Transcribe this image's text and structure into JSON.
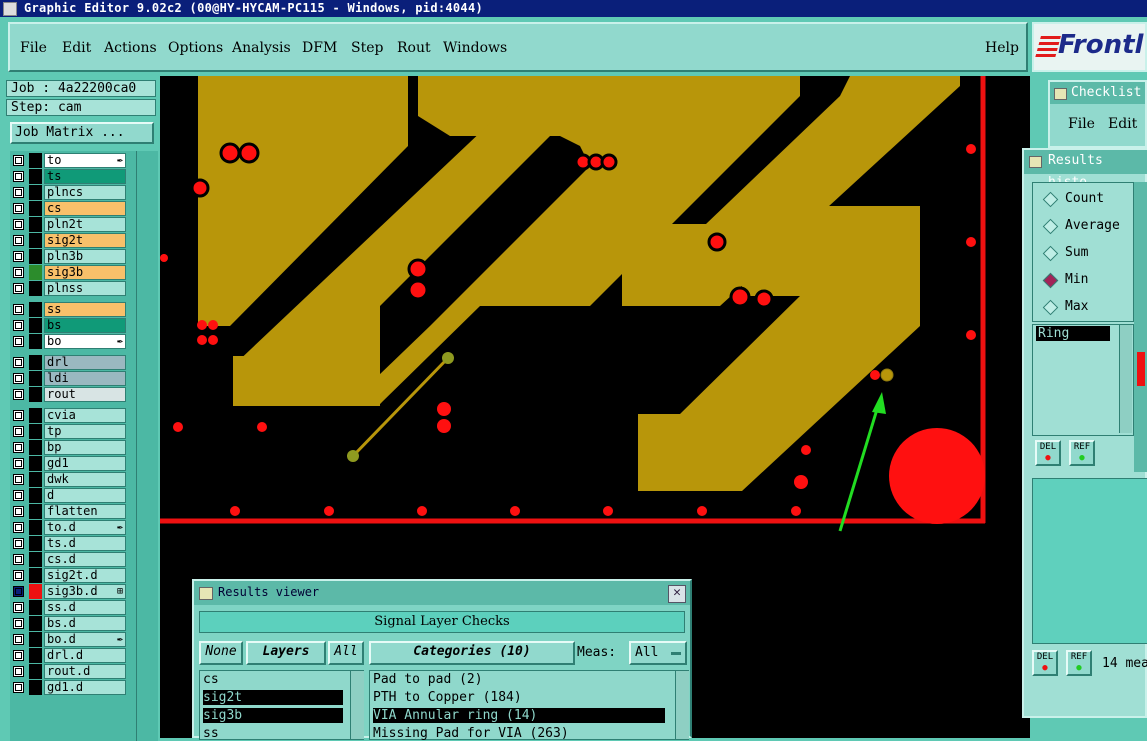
{
  "window": {
    "title": "Graphic Editor 9.02c2 (00@HY-HYCAM-PC115 - Windows, pid:4044)"
  },
  "menu": {
    "items": [
      "File",
      "Edit",
      "Actions",
      "Options",
      "Analysis",
      "DFM",
      "Step",
      "Rout",
      "Windows"
    ],
    "help": "Help"
  },
  "brand": {
    "text": "Frontl"
  },
  "job": {
    "job_label": "Job : 4a22200ca0",
    "step_label": "Step: cam",
    "matrix_button": "Job Matrix ..."
  },
  "layers": [
    {
      "name": "to",
      "color": "#ffffff",
      "swatch": "#000000",
      "mark": "✒"
    },
    {
      "name": "ts",
      "color": "#109a78",
      "swatch": "#000000",
      "mark": ""
    },
    {
      "name": "plncs",
      "color": "#a7e3d8",
      "swatch": "#000000",
      "mark": ""
    },
    {
      "name": "cs",
      "color": "#f8c06a",
      "swatch": "#000000",
      "mark": ""
    },
    {
      "name": "pln2t",
      "color": "#a7e3d8",
      "swatch": "#000000",
      "mark": ""
    },
    {
      "name": "sig2t",
      "color": "#f8c06a",
      "swatch": "#000000",
      "mark": ""
    },
    {
      "name": "pln3b",
      "color": "#a7e3d8",
      "swatch": "#000000",
      "mark": ""
    },
    {
      "name": "sig3b",
      "color": "#f8c06a",
      "swatch": "#2c8c2c",
      "mark": ""
    },
    {
      "name": "plnss",
      "color": "#a7e3d8",
      "swatch": "#000000",
      "mark": ""
    },
    {
      "name": "ss",
      "color": "#f8c06a",
      "swatch": "#000000",
      "mark": ""
    },
    {
      "name": "bs",
      "color": "#109a78",
      "swatch": "#000000",
      "mark": ""
    },
    {
      "name": "bo",
      "color": "#ffffff",
      "swatch": "#000000",
      "mark": "✒"
    },
    {
      "name": "drl",
      "color": "#9ab8c0",
      "swatch": "#000000",
      "mark": ""
    },
    {
      "name": "ldi",
      "color": "#9ab8c0",
      "swatch": "#000000",
      "mark": ""
    },
    {
      "name": "rout",
      "color": "#d8e4e4",
      "swatch": "#000000",
      "mark": ""
    },
    {
      "name": "cvia",
      "color": "#a7e3d8",
      "swatch": "#000000",
      "mark": ""
    },
    {
      "name": "tp",
      "color": "#a7e3d8",
      "swatch": "#000000",
      "mark": ""
    },
    {
      "name": "bp",
      "color": "#a7e3d8",
      "swatch": "#000000",
      "mark": ""
    },
    {
      "name": "gd1",
      "color": "#a7e3d8",
      "swatch": "#000000",
      "mark": ""
    },
    {
      "name": "dwk",
      "color": "#a7e3d8",
      "swatch": "#000000",
      "mark": ""
    },
    {
      "name": "d",
      "color": "#a7e3d8",
      "swatch": "#000000",
      "mark": ""
    },
    {
      "name": "flatten",
      "color": "#a7e3d8",
      "swatch": "#000000",
      "mark": ""
    },
    {
      "name": "to.d",
      "color": "#a7e3d8",
      "swatch": "#000000",
      "mark": "✒"
    },
    {
      "name": "ts.d",
      "color": "#a7e3d8",
      "swatch": "#000000",
      "mark": ""
    },
    {
      "name": "cs.d",
      "color": "#a7e3d8",
      "swatch": "#000000",
      "mark": ""
    },
    {
      "name": "sig2t.d",
      "color": "#a7e3d8",
      "swatch": "#000000",
      "mark": ""
    },
    {
      "name": "sig3b.d",
      "color": "#a7e3d8",
      "swatch": "#ee1111",
      "mark": "⊞"
    },
    {
      "name": "ss.d",
      "color": "#a7e3d8",
      "swatch": "#000000",
      "mark": ""
    },
    {
      "name": "bs.d",
      "color": "#a7e3d8",
      "swatch": "#000000",
      "mark": ""
    },
    {
      "name": "bo.d",
      "color": "#a7e3d8",
      "swatch": "#000000",
      "mark": "✒"
    },
    {
      "name": "drl.d",
      "color": "#a7e3d8",
      "swatch": "#000000",
      "mark": ""
    },
    {
      "name": "rout.d",
      "color": "#a7e3d8",
      "swatch": "#000000",
      "mark": ""
    },
    {
      "name": "gd1.d",
      "color": "#a7e3d8",
      "swatch": "#000000",
      "mark": ""
    }
  ],
  "results_viewer": {
    "title": "Results viewer",
    "check_name": "Signal Layer Checks",
    "none_button": "None",
    "layers_button": "Layers",
    "all_button": "All",
    "categories_button": "Categories (10)",
    "meas_label": "Meas:",
    "meas_value": "All",
    "layer_items": [
      "cs",
      "sig2t",
      "sig3b",
      "ss"
    ],
    "selected_layers": [
      "sig2t",
      "sig3b"
    ],
    "category_items": [
      "Pad to pad (2)",
      "PTH to Copper (184)",
      "VIA Annular ring (14)",
      "Missing Pad for VIA (263)"
    ],
    "selected_category": "VIA Annular ring (14)"
  },
  "checklist": {
    "title": "Checklist",
    "file": "File",
    "edit": "Edit"
  },
  "results_histogram": {
    "title": "Results histo",
    "options": [
      {
        "label": "Count",
        "selected": false
      },
      {
        "label": "Average",
        "selected": false
      },
      {
        "label": "Sum",
        "selected": false
      },
      {
        "label": "Min",
        "selected": true
      },
      {
        "label": "Max",
        "selected": false
      }
    ],
    "field": "Ring",
    "del_label": "DEL",
    "ref_label": "REF",
    "count_text": "14 mea"
  },
  "colors": {
    "copper": "#b8960a",
    "pad_red": "#ff1010",
    "arrow_green": "#22dd22",
    "titlebar_bg": "#0a1f7a",
    "panel_bg": "#91d9cd"
  }
}
